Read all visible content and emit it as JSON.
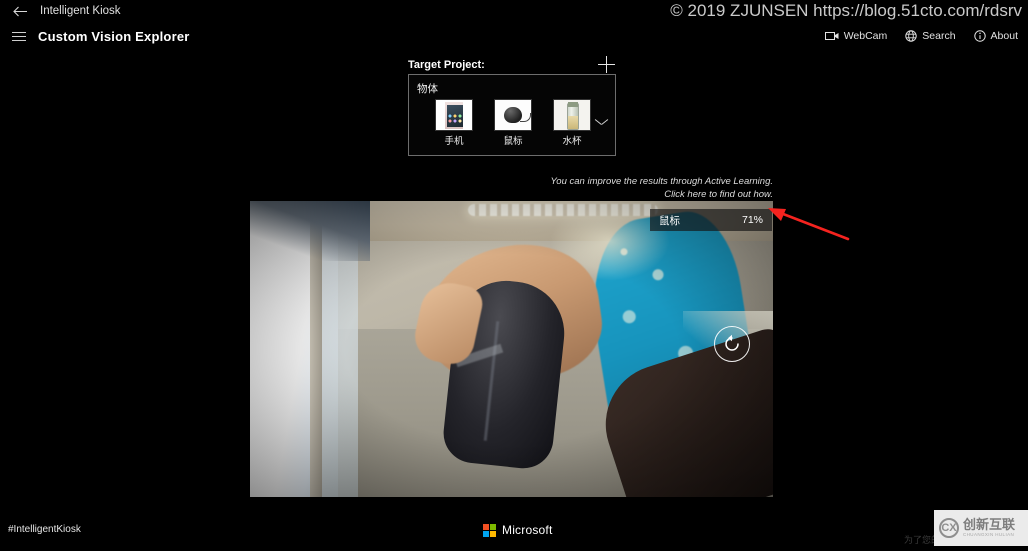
{
  "titlebar": {
    "back_icon": "back-arrow-icon",
    "app_name": "Intelligent Kiosk"
  },
  "commandbar": {
    "menu_icon": "hamburger-menu-icon",
    "page_title": "Custom Vision Explorer",
    "actions": [
      {
        "label": "WebCam",
        "icon": "webcam-icon"
      },
      {
        "label": "Search",
        "icon": "globe-search-icon"
      },
      {
        "label": "About",
        "icon": "info-circle-icon"
      }
    ]
  },
  "target_project": {
    "label": "Target Project:",
    "add_icon": "plus-icon",
    "expand_icon": "chevron-down-icon",
    "project_name": "物体",
    "tags": [
      {
        "name": "手机",
        "thumb": "smartphone-thumbnail"
      },
      {
        "name": "鼠标",
        "thumb": "computer-mouse-thumbnail"
      },
      {
        "name": "水杯",
        "thumb": "water-bottle-thumbnail"
      }
    ]
  },
  "hint": {
    "line1": "You can improve the results through Active Learning.",
    "line2": "Click here to find out how."
  },
  "video": {
    "prediction": {
      "label": "鼠标",
      "probability": "71%"
    },
    "refresh_icon": "rotate-refresh-icon",
    "annotation_arrow": "red-pointer-arrow"
  },
  "footer": {
    "hashtag": "#IntelligentKiosk",
    "brand": "Microsoft",
    "brand_colors": [
      "#f25022",
      "#7fba00",
      "#00a4ef",
      "#ffb900"
    ]
  },
  "watermarks": {
    "top": "© 2019 ZJUNSEN https://blog.51cto.com/rdsrv",
    "faint": "为了您的",
    "logo_mark": "CX",
    "logo_cn": "创新互联",
    "logo_en": "CHUANGXIN HULIAN"
  }
}
